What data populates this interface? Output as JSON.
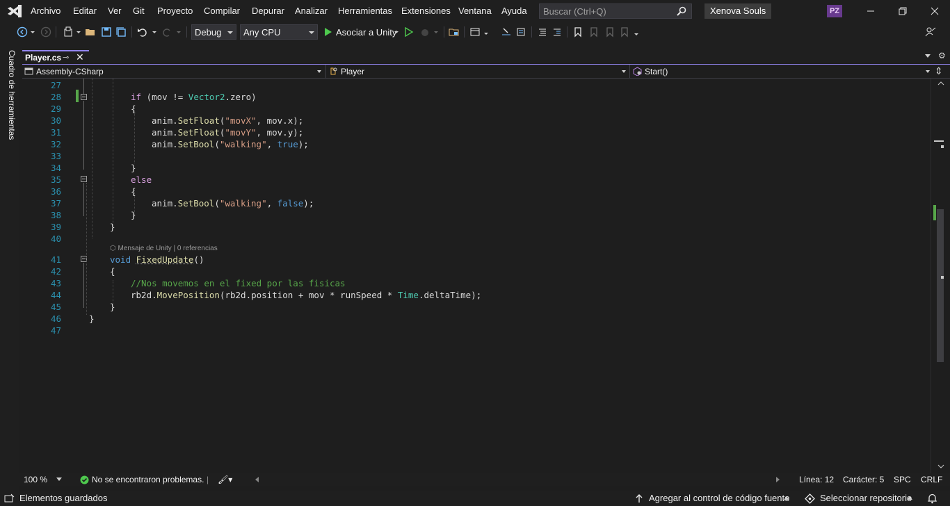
{
  "menu": [
    "Archivo",
    "Editar",
    "Ver",
    "Git",
    "Proyecto",
    "Compilar",
    "Depurar",
    "Analizar",
    "Herramientas",
    "Extensiones",
    "Ventana",
    "Ayuda"
  ],
  "search": {
    "placeholder": "Buscar (Ctrl+Q)"
  },
  "solution_name": "Xenova Souls",
  "user_initials": "PZ",
  "toolbar": {
    "configuration": "Debug",
    "platform": "Any CPU",
    "run_label": "Asociar a Unity"
  },
  "toolstrip_label": "Cuadro de herramientas",
  "tab": {
    "name": "Player.cs"
  },
  "nav": {
    "project": "Assembly-CSharp",
    "type": "Player",
    "member": "Start()"
  },
  "codelens": "Mensaje de Unity | 0 referencias",
  "lines": [
    {
      "n": "27",
      "tokens": []
    },
    {
      "n": "28",
      "tokens": [
        [
          "ctl",
          "if"
        ],
        [
          "vr",
          " (mov != "
        ],
        [
          "ty",
          "Vector2"
        ],
        [
          "vr",
          ".zero)"
        ]
      ]
    },
    {
      "n": "29",
      "tokens": [
        [
          "vr",
          "{"
        ]
      ]
    },
    {
      "n": "30",
      "tokens": [
        [
          "vr",
          "anim."
        ],
        [
          "mt",
          "SetFloat"
        ],
        [
          "vr",
          "("
        ],
        [
          "str",
          "\"movX\""
        ],
        [
          "vr",
          ", mov.x);"
        ]
      ]
    },
    {
      "n": "31",
      "tokens": [
        [
          "vr",
          "anim."
        ],
        [
          "mt",
          "SetFloat"
        ],
        [
          "vr",
          "("
        ],
        [
          "str",
          "\"movY\""
        ],
        [
          "vr",
          ", mov.y);"
        ]
      ]
    },
    {
      "n": "32",
      "tokens": [
        [
          "vr",
          "anim."
        ],
        [
          "mt",
          "SetBool"
        ],
        [
          "vr",
          "("
        ],
        [
          "str",
          "\"walking\""
        ],
        [
          "vr",
          ", "
        ],
        [
          "kw",
          "true"
        ],
        [
          "vr",
          ");"
        ]
      ]
    },
    {
      "n": "33",
      "tokens": []
    },
    {
      "n": "34",
      "tokens": [
        [
          "vr",
          "}"
        ]
      ]
    },
    {
      "n": "35",
      "tokens": [
        [
          "ctl",
          "else"
        ]
      ]
    },
    {
      "n": "36",
      "tokens": [
        [
          "vr",
          "{"
        ]
      ]
    },
    {
      "n": "37",
      "tokens": [
        [
          "vr",
          "anim."
        ],
        [
          "mt",
          "SetBool"
        ],
        [
          "vr",
          "("
        ],
        [
          "str",
          "\"walking\""
        ],
        [
          "vr",
          ", "
        ],
        [
          "kw",
          "false"
        ],
        [
          "vr",
          ");"
        ]
      ]
    },
    {
      "n": "38",
      "tokens": [
        [
          "vr",
          "}"
        ]
      ]
    },
    {
      "n": "39",
      "tokens": [
        [
          "vr",
          "}"
        ]
      ]
    },
    {
      "n": "40",
      "tokens": []
    },
    {
      "n": "41",
      "tokens": [
        [
          "kw",
          "void"
        ],
        [
          "vr",
          " "
        ],
        [
          "mt",
          "FixedUpdate"
        ],
        [
          "vr",
          "()"
        ]
      ]
    },
    {
      "n": "42",
      "tokens": [
        [
          "vr",
          "{"
        ]
      ]
    },
    {
      "n": "43",
      "tokens": [
        [
          "cm",
          "//Nos movemos en el fixed por las fisicas"
        ]
      ]
    },
    {
      "n": "44",
      "tokens": [
        [
          "vr",
          "rb2d."
        ],
        [
          "mt",
          "MovePosition"
        ],
        [
          "vr",
          "(rb2d.position + mov * runSpeed * "
        ],
        [
          "ty",
          "Time"
        ],
        [
          "vr",
          ".deltaTime);"
        ]
      ]
    },
    {
      "n": "45",
      "tokens": [
        [
          "vr",
          "}"
        ]
      ]
    },
    {
      "n": "46",
      "tokens": [
        [
          "vr",
          "}"
        ]
      ]
    },
    {
      "n": "47",
      "tokens": []
    }
  ],
  "editor_status": {
    "zoom": "100 %",
    "issues": "No se encontraron problemas.",
    "line": "Línea: 12",
    "char": "Carácter: 5",
    "spc": "SPC",
    "crlf": "CRLF"
  },
  "statusbar": {
    "left": "Elementos guardados",
    "source_control": "Agregar al control de código fuente",
    "repo": "Seleccionar repositorio"
  },
  "colors": {
    "accent": "#9184ee",
    "line_numbers": "#2b91af",
    "change_saved": "#57a64a"
  }
}
